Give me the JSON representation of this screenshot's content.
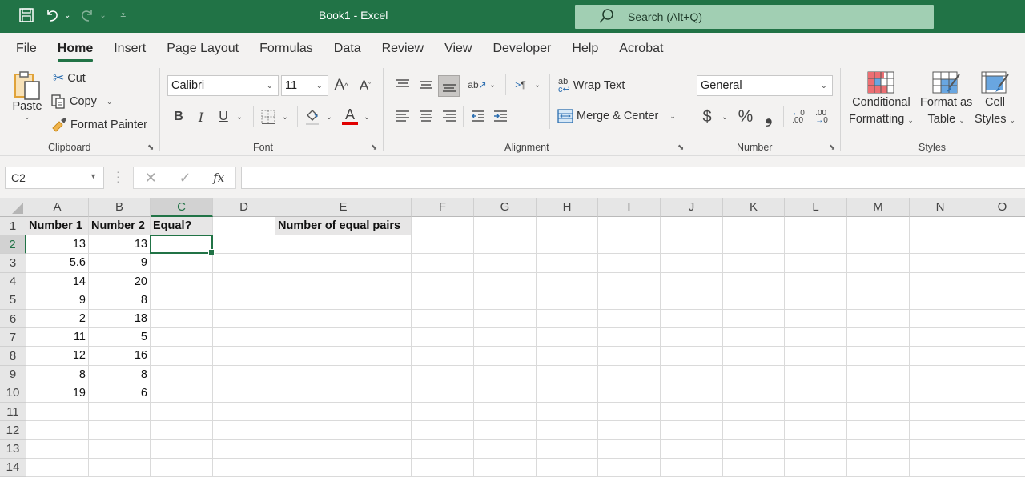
{
  "titlebar": {
    "title": "Book1  -  Excel",
    "search_placeholder": "Search (Alt+Q)",
    "qat": [
      "save-icon",
      "undo-icon",
      "redo-icon",
      "customize-qat-icon"
    ]
  },
  "tabs": [
    {
      "label": "File",
      "active": false
    },
    {
      "label": "Home",
      "active": true
    },
    {
      "label": "Insert",
      "active": false
    },
    {
      "label": "Page Layout",
      "active": false
    },
    {
      "label": "Formulas",
      "active": false
    },
    {
      "label": "Data",
      "active": false
    },
    {
      "label": "Review",
      "active": false
    },
    {
      "label": "View",
      "active": false
    },
    {
      "label": "Developer",
      "active": false
    },
    {
      "label": "Help",
      "active": false
    },
    {
      "label": "Acrobat",
      "active": false
    }
  ],
  "ribbon": {
    "clipboard": {
      "label": "Clipboard",
      "paste": "Paste",
      "cut": "Cut",
      "copy": "Copy",
      "format_painter": "Format Painter"
    },
    "font": {
      "label": "Font",
      "font_name": "Calibri",
      "font_size": "11",
      "bold": "B",
      "italic": "I",
      "underline": "U",
      "grow": "A",
      "shrink": "A",
      "font_color": "A",
      "font_color_hex": "#e00000"
    },
    "alignment": {
      "label": "Alignment",
      "wrap_text": "Wrap Text",
      "merge_center": "Merge & Center"
    },
    "number": {
      "label": "Number",
      "format": "General",
      "currency": "$",
      "percent": "%",
      "comma": "9",
      "inc_decimal": "←0 .00",
      "dec_decimal": ".00 →0"
    },
    "styles": {
      "label": "Styles",
      "conditional_formatting": [
        "Conditional",
        "Formatting"
      ],
      "format_as_table": [
        "Format as",
        "Table"
      ],
      "cell_styles": [
        "Cell",
        "Styles"
      ]
    }
  },
  "formula_bar": {
    "name_box": "C2",
    "cancel": "✕",
    "enter": "✓",
    "fx": "fx",
    "value": ""
  },
  "sheet": {
    "selected_cell": "C2",
    "columns": [
      "A",
      "B",
      "C",
      "D",
      "E",
      "F",
      "G",
      "H",
      "I",
      "J",
      "K",
      "L",
      "M",
      "N",
      "O"
    ],
    "rows": [
      "1",
      "2",
      "3",
      "4",
      "5",
      "6",
      "7",
      "8",
      "9",
      "10",
      "11",
      "12",
      "13",
      "14"
    ],
    "headers": {
      "A1": "Number 1",
      "B1": "Number 2",
      "C1": "Equal?",
      "E1": "Number of equal pairs"
    },
    "number1": [
      "13",
      "5.6",
      "14",
      "9",
      "2",
      "11",
      "12",
      "8",
      "19"
    ],
    "number2": [
      "13",
      "9",
      "20",
      "8",
      "18",
      "5",
      "16",
      "8",
      "6"
    ]
  },
  "colors": {
    "brand_green": "#217346",
    "search_bg": "#a1cfb3",
    "ribbon_bg": "#f3f2f1",
    "header_cell_bg": "#e7e6e6"
  }
}
